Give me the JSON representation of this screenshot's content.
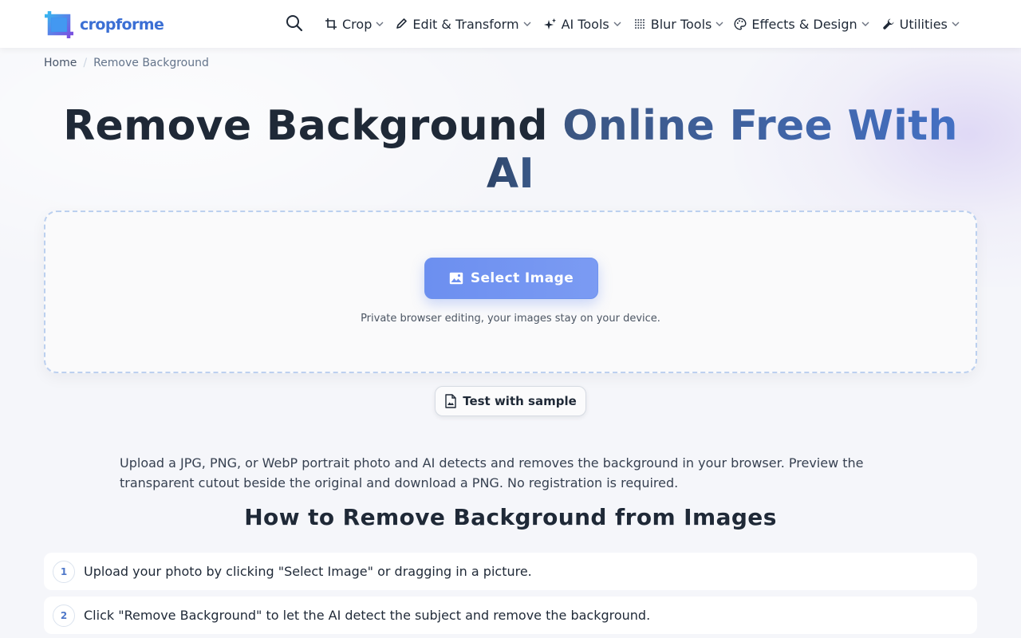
{
  "header": {
    "logo_text": "cropforme",
    "nav": [
      {
        "label": "Crop",
        "icon": "crop-icon"
      },
      {
        "label": "Edit & Transform",
        "icon": "pencil-icon"
      },
      {
        "label": "AI Tools",
        "icon": "sparkle-icon"
      },
      {
        "label": "Blur Tools",
        "icon": "blur-dots-icon"
      },
      {
        "label": "Effects & Design",
        "icon": "palette-icon"
      },
      {
        "label": "Utilities",
        "icon": "wrench-icon"
      }
    ]
  },
  "breadcrumb": {
    "home": "Home",
    "current": "Remove Background"
  },
  "title": {
    "part1": "Remove Background ",
    "part2": "Online Free With",
    "part3": "AI"
  },
  "dropzone": {
    "button_label": "Select Image",
    "privacy": "Private browser editing, your images stay on your device."
  },
  "sample_button": "Test with sample",
  "intro": "Upload a JPG, PNG, or WebP portrait photo and AI detects and removes the background in your browser. Preview the transparent cutout beside the original and download a PNG. No registration is required.",
  "how_to": {
    "heading": "How to Remove Background from Images",
    "steps": [
      {
        "num": "1",
        "text": "Upload your photo by clicking \"Select Image\" or dragging in a picture."
      },
      {
        "num": "2",
        "text": "Click \"Remove Background\" to let the AI detect the subject and remove the background."
      }
    ]
  },
  "colors": {
    "accent": "#6c8ff0",
    "logo": "#3b6fd4",
    "title_gradient_end": "#4470c4"
  }
}
